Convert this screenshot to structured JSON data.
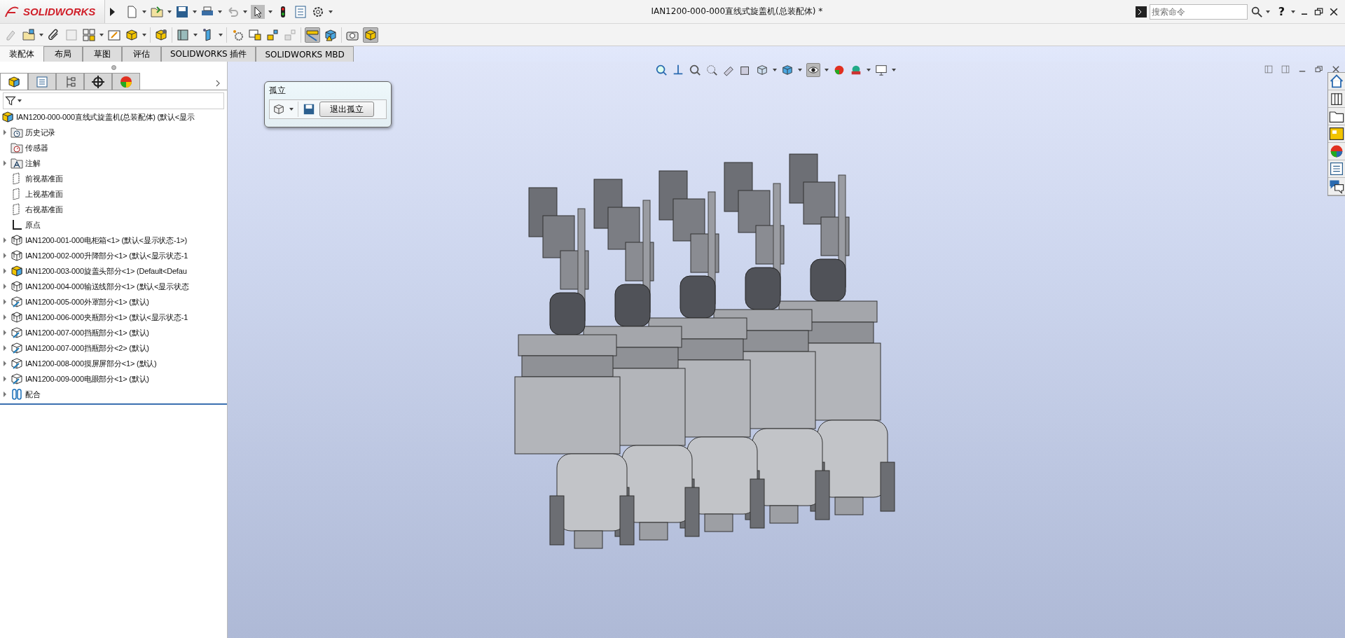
{
  "app": {
    "logo": "SOLIDWORKS",
    "title": "IAN1200-000-000直线式旋盖机(总装配体) *",
    "search": {
      "placeholder": "搜索命令"
    },
    "help": "?"
  },
  "command_tabs": [
    {
      "label": "装配体",
      "selected": true
    },
    {
      "label": "布局",
      "selected": false
    },
    {
      "label": "草图",
      "selected": false
    },
    {
      "label": "评估",
      "selected": false
    },
    {
      "label": "SOLIDWORKS 插件",
      "selected": false
    },
    {
      "label": "SOLIDWORKS MBD",
      "selected": false
    }
  ],
  "panel_tabs": [
    {
      "selected": true
    },
    {
      "selected": false
    },
    {
      "selected": false
    },
    {
      "selected": false
    },
    {
      "selected": false
    }
  ],
  "tree": {
    "root": "IAN1200-000-000直线式旋盖机(总装配体)  (默认<显示",
    "items": [
      {
        "kind": "history",
        "label": "历史记录",
        "expanded": false
      },
      {
        "kind": "sensor",
        "label": "传感器"
      },
      {
        "kind": "annotation",
        "label": "注解",
        "expanded": false
      },
      {
        "kind": "plane",
        "label": "前视基准面"
      },
      {
        "kind": "plane",
        "label": "上视基准面"
      },
      {
        "kind": "plane",
        "label": "右视基准面"
      },
      {
        "kind": "origin",
        "label": "原点"
      },
      {
        "kind": "assembly",
        "label": "IAN1200-001-000电柜箱<1> (默认<显示状态-1>)",
        "expanded": false
      },
      {
        "kind": "assembly",
        "label": "IAN1200-002-000升降部分<1> (默认<显示状态-1",
        "expanded": false
      },
      {
        "kind": "active-assembly",
        "label": "IAN1200-003-000旋盖头部分<1> (Default<Defau",
        "expanded": false
      },
      {
        "kind": "assembly",
        "label": "IAN1200-004-000输送线部分<1> (默认<显示状态",
        "expanded": false
      },
      {
        "kind": "flexible-assembly",
        "label": "IAN1200-005-000外罩部分<1> (默认)",
        "expanded": false
      },
      {
        "kind": "assembly",
        "label": "IAN1200-006-000夹瓶部分<1> (默认<显示状态-1",
        "expanded": false
      },
      {
        "kind": "flexible-assembly",
        "label": "IAN1200-007-000挡瓶部分<1> (默认)",
        "expanded": false
      },
      {
        "kind": "flexible-assembly",
        "label": "IAN1200-007-000挡瓶部分<2> (默认)",
        "expanded": false
      },
      {
        "kind": "flexible-assembly",
        "label": "IAN1200-008-000摸屏屏部分<1> (默认)",
        "expanded": false
      },
      {
        "kind": "flexible-assembly",
        "label": "IAN1200-009-000电眼部分<1> (默认)",
        "expanded": false
      },
      {
        "kind": "mates",
        "label": "配合",
        "expanded": false
      }
    ]
  },
  "isolate_popup": {
    "title": "孤立",
    "exit_button": "退出孤立"
  }
}
